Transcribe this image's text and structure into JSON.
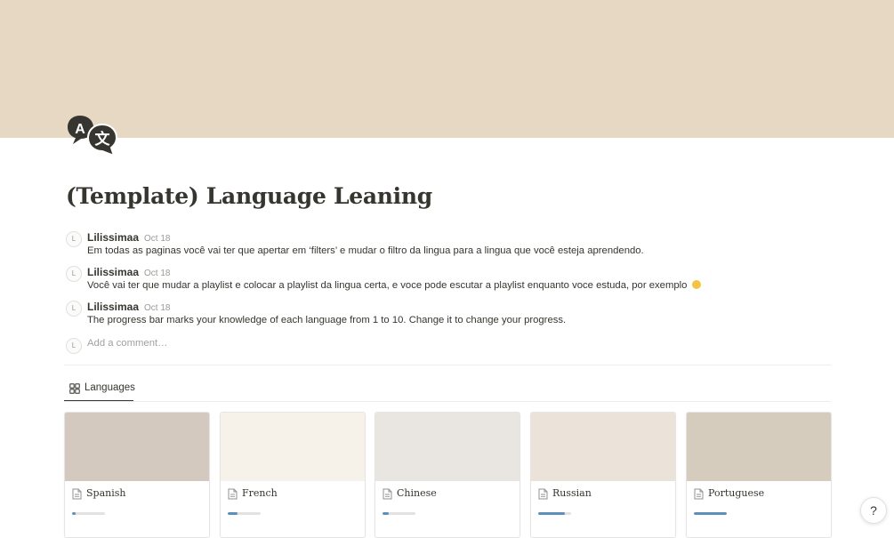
{
  "page": {
    "title": "(Template) Language Leaning",
    "cover_color": "#e6d8c3",
    "icon": "language-translate-icon"
  },
  "comments": [
    {
      "avatar": "L",
      "author": "Lilissimaa",
      "date": "Oct 18",
      "text": "Em todas as paginas você vai ter que apertar em ‘filters’ e mudar o filtro da lingua para a lingua que você esteja aprendendo."
    },
    {
      "avatar": "L",
      "author": "Lilissimaa",
      "date": "Oct 18",
      "text": "Você vai ter que mudar a playlist e colocar a playlist da lingua certa, e voce pode escutar a playlist enquanto voce estuda, por exemplo",
      "emoji": "smiling-face-emoji"
    },
    {
      "avatar": "L",
      "author": "Lilissimaa",
      "date": "Oct 18",
      "text": "The progress bar marks your knowledge of each language from 1 to 10. Change it to change your progress."
    }
  ],
  "add_comment": {
    "avatar": "L",
    "placeholder": "Add a comment…"
  },
  "database": {
    "tab_label": "Languages",
    "tab_icon": "gallery-grid-icon",
    "cards": [
      {
        "title": "Spanish",
        "cover": "#d3c9be",
        "progress": 0.1
      },
      {
        "title": "French",
        "cover": "#f6f2e9",
        "progress": 0.3
      },
      {
        "title": "Chinese",
        "cover": "#e9e5e0",
        "progress": 0.2
      },
      {
        "title": "Russian",
        "cover": "#ebe3d9",
        "progress": 0.8
      },
      {
        "title": "Portuguese",
        "cover": "#d5ccbd",
        "progress": 1.0
      }
    ]
  },
  "help": {
    "label": "?"
  },
  "colors": {
    "progress": "#5d8fbc",
    "text": "#37352f",
    "muted": "#9b9a97"
  }
}
